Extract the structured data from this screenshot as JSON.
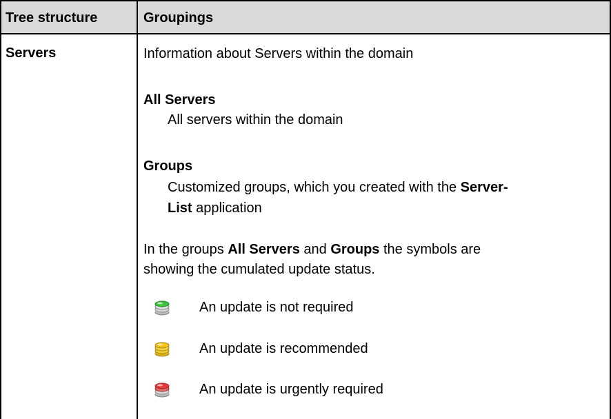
{
  "table": {
    "headers": {
      "tree_structure": "Tree structure",
      "groupings": "Groupings"
    },
    "row": {
      "tree_item": "Servers",
      "intro": "Information about Servers within the domain",
      "all_servers": {
        "title": "All Servers",
        "description": "All servers within the domain"
      },
      "groups": {
        "title": "Groups",
        "description_part1": "Customized groups, which you created with the ",
        "description_bold1": "Server-",
        "description_bold2": "List",
        "description_part2": " application"
      },
      "symbols_note": {
        "part1": "In the groups ",
        "bold1": "All Servers",
        "part2": " and ",
        "bold2": "Groups",
        "part3": " the symbols are",
        "line2": "showing the cumulated update status."
      },
      "statuses": [
        {
          "label": "An update is not required",
          "icon": "server-status-green-icon",
          "color": "#3cc23c"
        },
        {
          "label": "An update is recommended",
          "icon": "server-status-yellow-icon",
          "color": "#f2c318"
        },
        {
          "label": "An update is urgently required",
          "icon": "server-status-red-icon",
          "color": "#e43a3a"
        }
      ]
    }
  }
}
